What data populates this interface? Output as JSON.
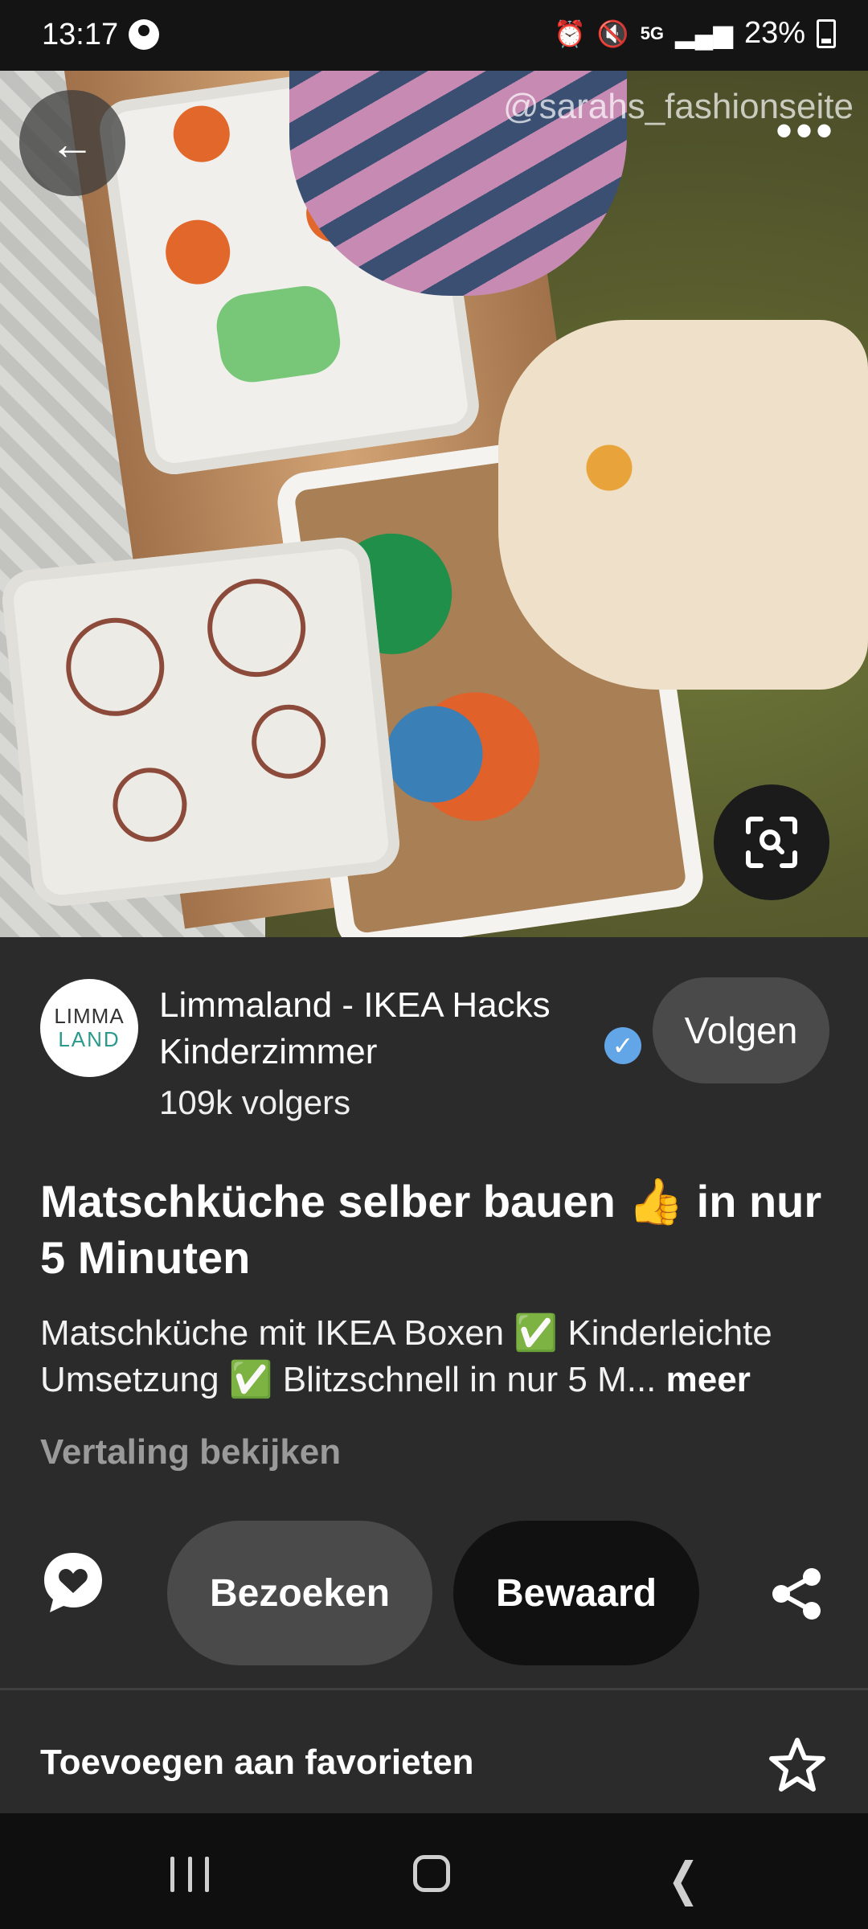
{
  "status_bar": {
    "time": "13:17",
    "icons": [
      "account-circle-icon",
      "alarm-icon",
      "mute-icon",
      "5g-icon",
      "signal-icon"
    ],
    "network": "5G",
    "battery": "23%"
  },
  "hero": {
    "watermark": "@sarahs_fashionseite",
    "back_icon": "←",
    "more_icon": "•••"
  },
  "creator": {
    "avatar_line1": "LIMMA",
    "avatar_line2": "LAND",
    "name": "Limmaland - IKEA Hacks Kinderzimmer",
    "verified_icon": "✓",
    "followers": "109k volgers",
    "follow_label": "Volgen"
  },
  "pin": {
    "title": "Matschküche selber bauen 👍 in nur 5 Minuten",
    "description": "Matschküche mit IKEA Boxen ✅ Kinderleichte Umsetzung ✅ Blitzschnell in nur 5 M...",
    "more_label": "meer",
    "translate_label": "Vertaling bekijken"
  },
  "actions": {
    "visit_label": "Bezoeken",
    "saved_label": "Bewaard"
  },
  "favorites": {
    "label": "Toevoegen aan favorieten"
  },
  "colors": {
    "background": "#2b2b2b",
    "button_grey": "#4a4a4a",
    "button_dark": "#111111",
    "verified_blue": "#63a6e8"
  }
}
